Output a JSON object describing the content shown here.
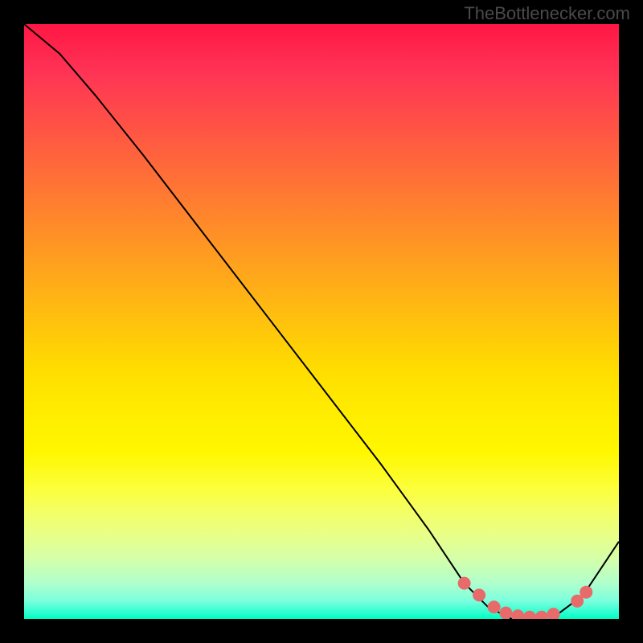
{
  "watermark": "TheBottlenecker.com",
  "chart_data": {
    "type": "line",
    "title": "",
    "xlabel": "",
    "ylabel": "",
    "xlim": [
      0,
      100
    ],
    "ylim": [
      0,
      100
    ],
    "series": [
      {
        "name": "curve",
        "x": [
          0,
          6,
          12,
          20,
          30,
          40,
          50,
          60,
          68,
          74,
          78,
          82,
          86,
          90,
          94,
          100
        ],
        "y": [
          100,
          95,
          88,
          78,
          65,
          52,
          39,
          26,
          15,
          6,
          2,
          0,
          0,
          1,
          4,
          13
        ]
      }
    ],
    "markers": {
      "name": "optimum-zone",
      "x": [
        74,
        76.5,
        79,
        81,
        83,
        85,
        87,
        89,
        93,
        94.5
      ],
      "y": [
        6,
        4,
        2,
        1,
        0.5,
        0.3,
        0.3,
        0.8,
        3,
        4.5
      ],
      "color": "#e86b6b"
    },
    "gradient_stops": {
      "top": "#ff1744",
      "mid": "#ffee00",
      "bottom": "#00ffc0"
    }
  }
}
